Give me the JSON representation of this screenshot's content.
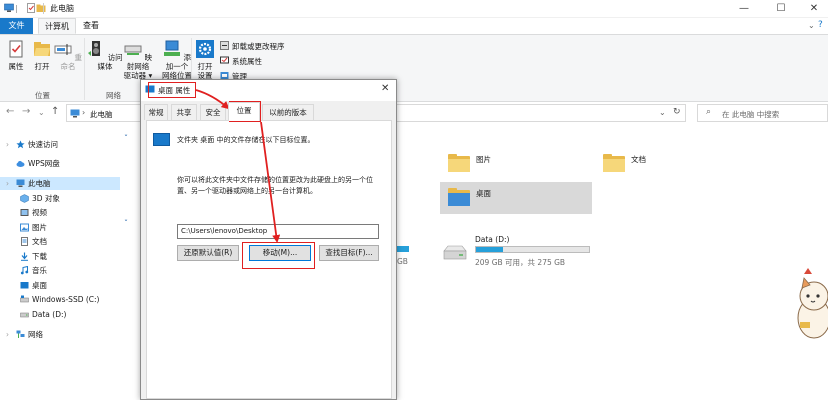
{
  "window": {
    "title": "此电脑",
    "minimize": "—",
    "maximize": "☐",
    "close": "✕"
  },
  "ribbon_tabs": [
    "文件",
    "计算机",
    "查看"
  ],
  "ribbon": {
    "location_buttons": [
      "属性",
      "打开",
      "重命名"
    ],
    "location_group": "位置",
    "network_buttons": [
      {
        "line1": "访问媒体",
        "line2": ""
      },
      {
        "line1": "映射网络",
        "line2": "驱动器 ▾"
      },
      {
        "line1": "添加一个",
        "line2": "网络位置"
      }
    ],
    "network_group": "网络",
    "system_buttons": [
      {
        "line1": "打开",
        "line2": "设置"
      }
    ],
    "system_items": [
      "卸载或更改程序",
      "系统属性",
      "管理"
    ]
  },
  "navbar": {
    "path": "此电脑",
    "search_placeholder": "在 此电脑 中搜索"
  },
  "sidebar": {
    "items": [
      "快速访问",
      "WPS网盘",
      "此电脑",
      "3D 对象",
      "视频",
      "图片",
      "文档",
      "下载",
      "音乐",
      "桌面",
      "Windows-SSD (C:)",
      "Data (D:)",
      "网络"
    ]
  },
  "content": {
    "folders": [
      "图片",
      "文档",
      "桌面"
    ],
    "drive": {
      "name": "Data (D:)",
      "space": "209 GB 可用，共 275 GB",
      "used_fraction": 0.24
    },
    "partial_left_label": "GB"
  },
  "dialog": {
    "title": "桌面 属性",
    "tabs": [
      "常规",
      "共享",
      "安全",
      "位置",
      "以前的版本"
    ],
    "description": "文件夹 桌面 中的文件存储在以下目标位置。",
    "info": "你可以将此文件夹中文件存储的位置更改为此硬盘上的另一个位置、另一个驱动器或网络上的另一台计算机。",
    "path_value": "C:\\Users\\lenovo\\Desktop",
    "buttons": [
      "还原默认值(R)",
      "移动(M)...",
      "查找目标(F)..."
    ]
  }
}
